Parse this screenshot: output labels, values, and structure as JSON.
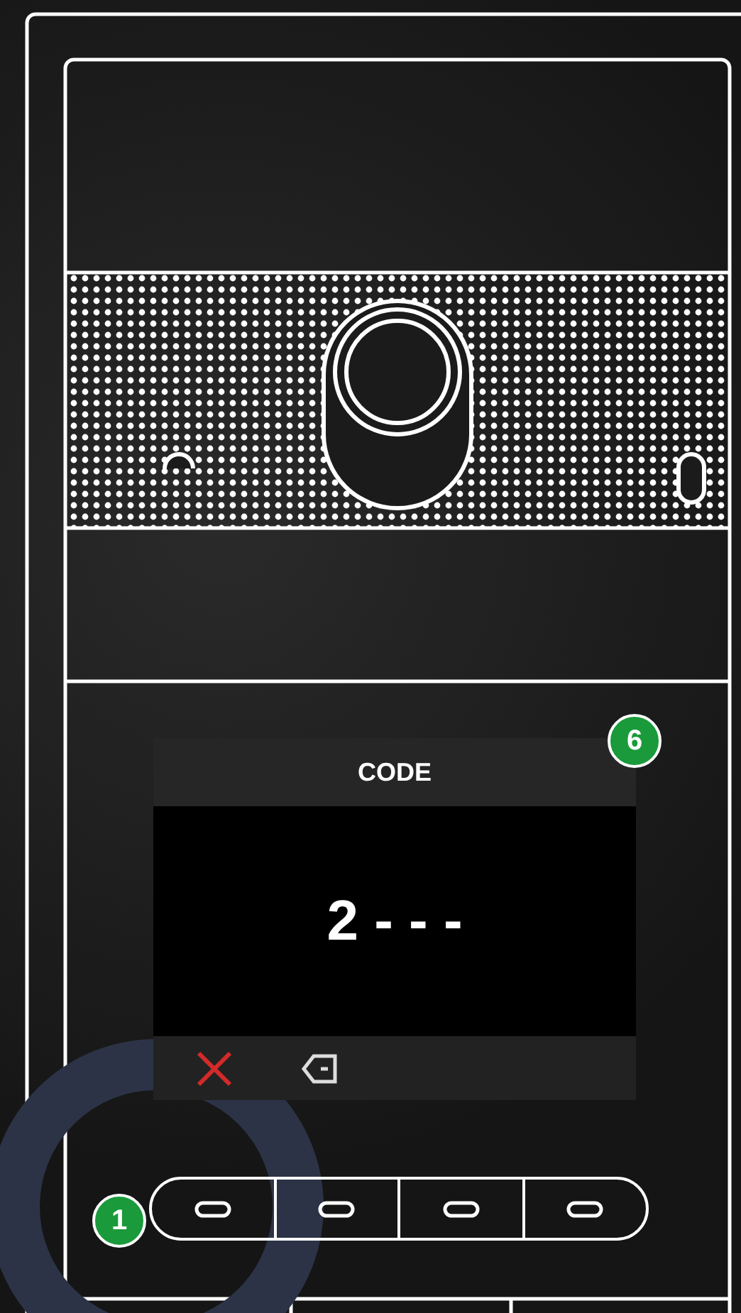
{
  "display": {
    "title": "CODE",
    "code": "2 - - -"
  },
  "callouts": [
    {
      "label": "6"
    },
    {
      "label": "1"
    }
  ]
}
